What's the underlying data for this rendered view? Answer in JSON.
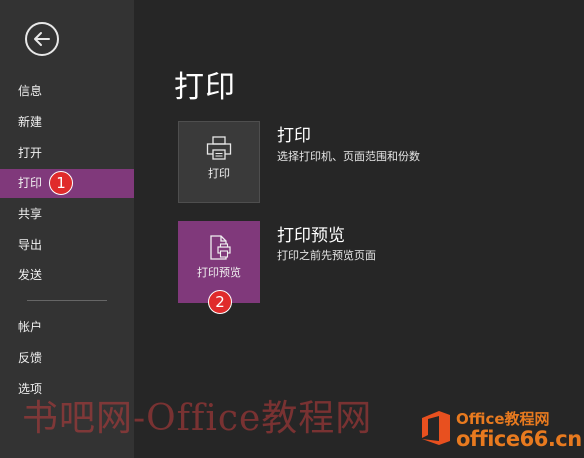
{
  "sidebar": {
    "items": [
      {
        "label": "信息"
      },
      {
        "label": "新建"
      },
      {
        "label": "打开"
      },
      {
        "label": "打印"
      },
      {
        "label": "共享"
      },
      {
        "label": "导出"
      },
      {
        "label": "发送"
      },
      {
        "label": "帐户"
      },
      {
        "label": "反馈"
      },
      {
        "label": "选项"
      }
    ],
    "selected_item": "打印"
  },
  "main": {
    "title": "打印",
    "options": [
      {
        "tile_label": "打印",
        "title": "打印",
        "description": "选择打印机、页面范围和份数",
        "icon": "printer-icon"
      },
      {
        "tile_label": "打印预览",
        "title": "打印预览",
        "description": "打印之前先预览页面",
        "icon": "print-preview-icon"
      }
    ]
  },
  "annotations": {
    "badge_1": "1",
    "badge_2": "2"
  },
  "watermark": {
    "text": "书吧网-Office教程网",
    "brand_top": "Office教程网",
    "brand_bottom": "office66.cn"
  },
  "colors": {
    "sidebar_bg": "#333333",
    "main_bg": "#262626",
    "accent_purple": "#80397b",
    "badge_red": "#e02b2b",
    "brand_orange": "#e87a1f"
  }
}
